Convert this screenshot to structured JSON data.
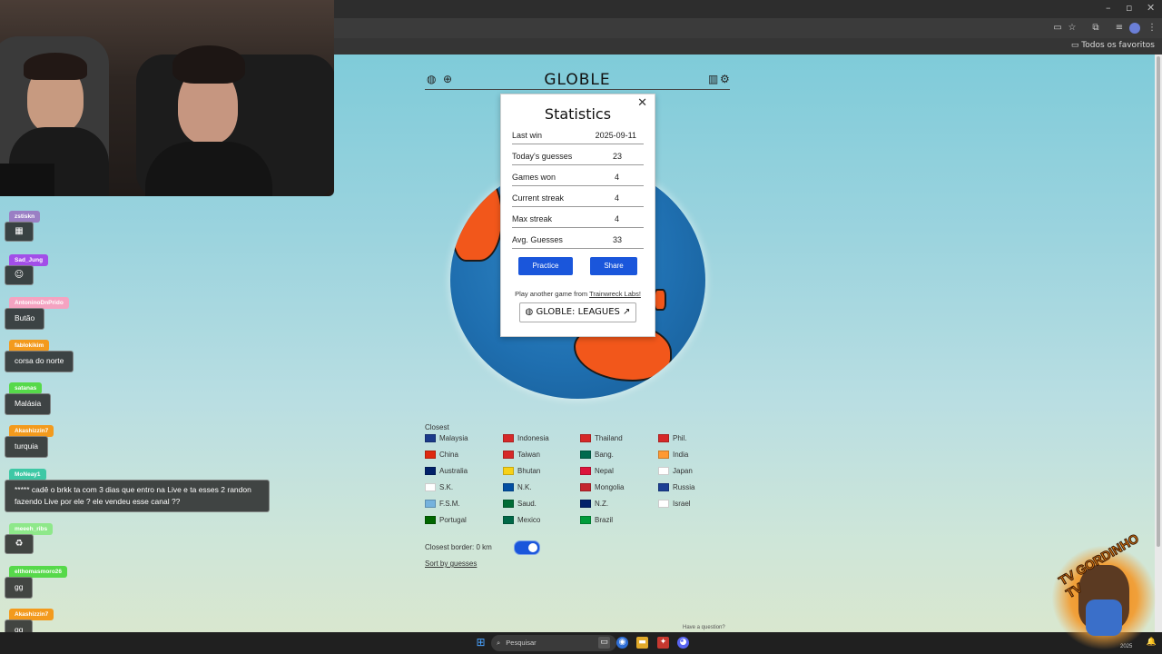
{
  "browser": {
    "bookmarks_label": "Todos os favoritos",
    "window_controls": [
      "–",
      "▫",
      "✕"
    ]
  },
  "app": {
    "title": "GLOBLE",
    "accent": "#1a56db",
    "land_color": "#f2571b",
    "ocean_color": "#1f6fb0"
  },
  "stats": {
    "title": "Statistics",
    "rows": [
      {
        "label": "Last win",
        "value": "2025-09-11"
      },
      {
        "label": "Today's guesses",
        "value": "23"
      },
      {
        "label": "Games won",
        "value": "4"
      },
      {
        "label": "Current streak",
        "value": "4"
      },
      {
        "label": "Max streak",
        "value": "4"
      },
      {
        "label": "Avg. Guesses",
        "value": "33"
      }
    ],
    "practice_label": "Practice",
    "share_label": "Share",
    "play_another_prefix": "Play another game from",
    "play_another_link": "Trainwreck Labs!",
    "leagues_label": "GLOBLE: LEAGUES",
    "close_symbol": "✕"
  },
  "closest": {
    "label": "Closest",
    "countries": [
      "Malaysia",
      "Indonesia",
      "Thailand",
      "Phil.",
      "China",
      "Taiwan",
      "Bang.",
      "India",
      "Australia",
      "Bhutan",
      "Nepal",
      "Japan",
      "S.K.",
      "N.K.",
      "Mongolia",
      "Russia",
      "F.S.M.",
      "Saud.",
      "N.Z.",
      "Israel",
      "Portugal",
      "Mexico",
      "Brazil"
    ],
    "flag_colors": [
      "#1a3a8a",
      "#d62828",
      "#d62828",
      "#d62828",
      "#de2910",
      "#d62828",
      "#006a4e",
      "#ff9933",
      "#012169",
      "#f7d117",
      "#dc143c",
      "#ffffff",
      "#ffffff",
      "#024fa2",
      "#c4272f",
      "#1c3f94",
      "#75b2dd",
      "#006c35",
      "#012169",
      "#ffffff",
      "#006600",
      "#006847",
      "#009c3b"
    ],
    "border_label": "Closest border: 0  km",
    "sort_label": "Sort by guesses",
    "question_label": "Have a question?"
  },
  "chat": {
    "messages": [
      {
        "user": "zstiskn",
        "text": "",
        "emote": "▦",
        "color": "#9a7fc4"
      },
      {
        "user": "Sad_Jung",
        "text": "",
        "emote": "☺",
        "color": "#a24ee8"
      },
      {
        "user": "AntoninoDnPrido",
        "text": "Butão",
        "color": "#f4a3c1"
      },
      {
        "user": "fablokikim",
        "text": "corsa do norte",
        "color": "#f39a1d"
      },
      {
        "user": "satanas",
        "text": "Malásia",
        "color": "#56d94a"
      },
      {
        "user": "Akashizzin7",
        "text": "turquia",
        "color": "#f39a1d"
      },
      {
        "user": "MoNeay1",
        "text": "***** cadê o brkk ta com 3 dias que entro na Live e ta esses 2 randon fazendo Live por ele ? ele vendeu esse canal ??",
        "color": "#3ec8a5"
      },
      {
        "user": "meeeh_ribs",
        "text": "",
        "emote": "♻",
        "color": "#8ee88a"
      },
      {
        "user": "elthomasmoro26",
        "text": "gg",
        "color": "#56d94a"
      },
      {
        "user": "Akashizzin7",
        "text": "gg",
        "color": "#f39a1d"
      }
    ]
  },
  "taskbar": {
    "search_placeholder": "Pesquisar",
    "date": "2025"
  },
  "logo": {
    "text": "TV GORDINHO TV"
  }
}
